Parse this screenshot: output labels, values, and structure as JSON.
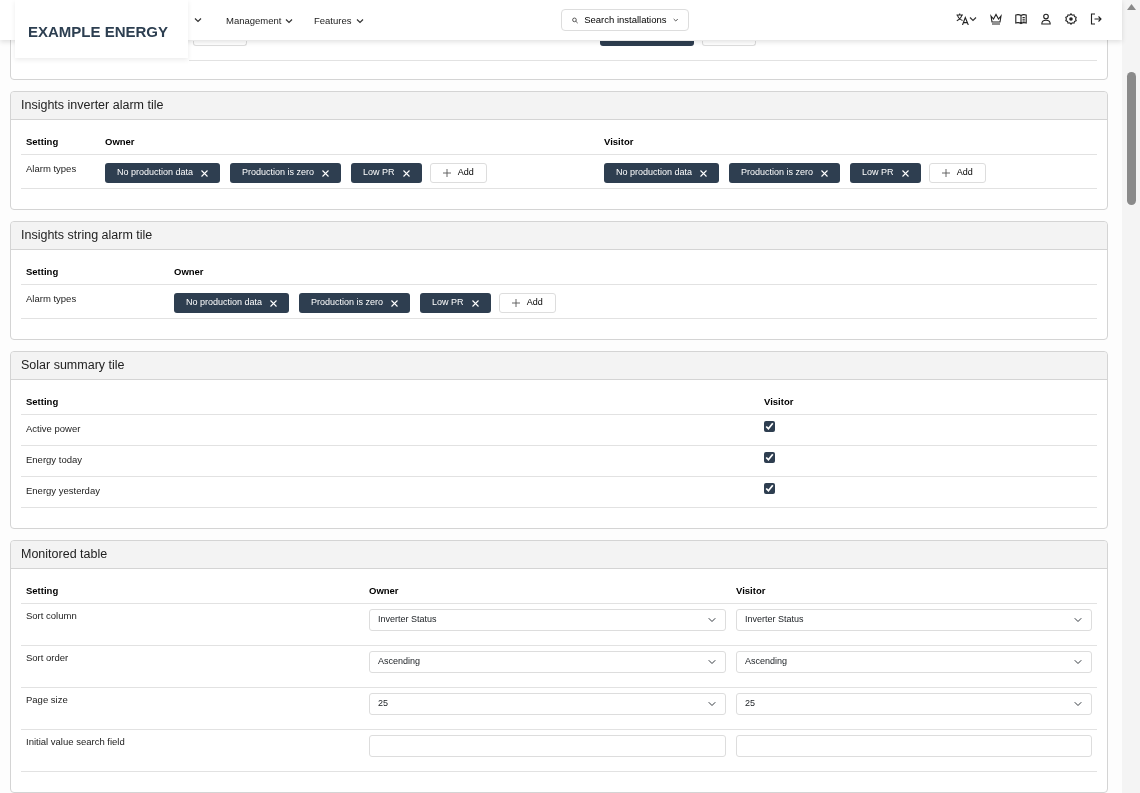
{
  "header": {
    "logo": "EXAMPLE ENERGY",
    "nav": [
      {
        "label": "Management"
      },
      {
        "label": "Features"
      }
    ],
    "search": {
      "label": "Search installations"
    }
  },
  "sections": [
    {
      "title": "Insights inverter alarm tile",
      "columns": [
        "Setting",
        "Owner",
        "Visitor"
      ],
      "rows": [
        {
          "cells": [
            {
              "kind": "text",
              "text": "Alarm types"
            },
            {
              "kind": "tags",
              "tags": [
                "No production data",
                "Production is zero",
                "Low PR"
              ],
              "add": "Add"
            },
            {
              "kind": "tags",
              "tags": [
                "No production data",
                "Production is zero",
                "Low PR"
              ],
              "add": "Add"
            }
          ]
        }
      ]
    },
    {
      "title": "Insights string alarm tile",
      "columns": [
        "Setting",
        "Owner"
      ],
      "rows": [
        {
          "cells": [
            {
              "kind": "text",
              "text": "Alarm types"
            },
            {
              "kind": "tags",
              "tags": [
                "No production data",
                "Production is zero",
                "Low PR"
              ],
              "add": "Add"
            }
          ]
        }
      ]
    },
    {
      "title": "Solar summary tile",
      "columns": [
        "Setting",
        "Visitor"
      ],
      "rows": [
        {
          "cells": [
            {
              "kind": "text",
              "text": "Active power"
            },
            {
              "kind": "checkbox",
              "checked": true
            }
          ]
        },
        {
          "cells": [
            {
              "kind": "text",
              "text": "Energy today"
            },
            {
              "kind": "checkbox",
              "checked": true
            }
          ]
        },
        {
          "cells": [
            {
              "kind": "text",
              "text": "Energy yesterday"
            },
            {
              "kind": "checkbox",
              "checked": true
            }
          ]
        }
      ]
    },
    {
      "title": "Monitored table",
      "columns": [
        "Setting",
        "Owner",
        "Visitor"
      ],
      "rows": [
        {
          "cells": [
            {
              "kind": "text",
              "text": "Sort column"
            },
            {
              "kind": "select",
              "value": "Inverter Status"
            },
            {
              "kind": "select",
              "value": "Inverter Status"
            }
          ]
        },
        {
          "cells": [
            {
              "kind": "text",
              "text": "Sort order"
            },
            {
              "kind": "select",
              "value": "Ascending"
            },
            {
              "kind": "select",
              "value": "Ascending"
            }
          ]
        },
        {
          "cells": [
            {
              "kind": "text",
              "text": "Page size"
            },
            {
              "kind": "select",
              "value": "25"
            },
            {
              "kind": "select",
              "value": "25"
            }
          ]
        },
        {
          "cells": [
            {
              "kind": "text",
              "text": "Initial value search field"
            },
            {
              "kind": "input"
            },
            {
              "kind": "input"
            }
          ]
        }
      ]
    }
  ]
}
